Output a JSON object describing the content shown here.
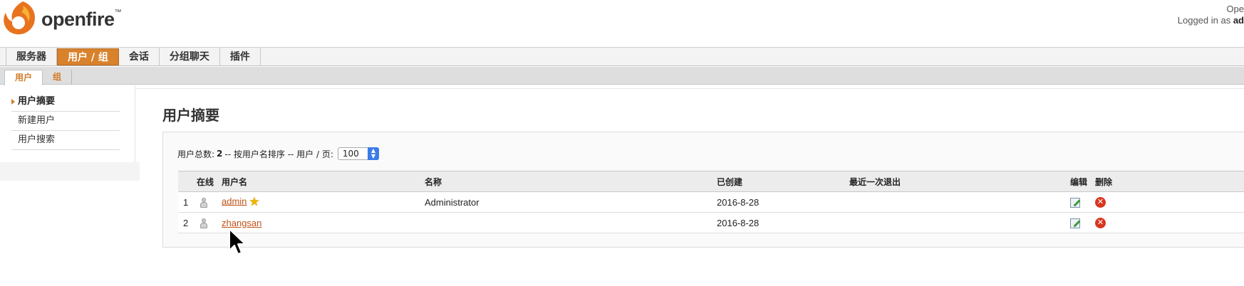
{
  "header": {
    "logo_text": "openfire",
    "logo_tm": "™",
    "info_line1": "Ope",
    "info_prefix": "Logged in as ",
    "info_user": "ad"
  },
  "main_nav": {
    "tabs": [
      {
        "label": "服务器",
        "active": false
      },
      {
        "label": "用户 / 组",
        "active": true
      },
      {
        "label": "会话",
        "active": false
      },
      {
        "label": "分组聊天",
        "active": false
      },
      {
        "label": "插件",
        "active": false
      }
    ]
  },
  "sub_nav": {
    "tabs": [
      {
        "label": "用户",
        "active": true
      },
      {
        "label": "组",
        "active": false
      }
    ]
  },
  "sidebar": {
    "items": [
      {
        "label": "用户摘要",
        "active": true
      },
      {
        "label": "新建用户",
        "active": false
      },
      {
        "label": "用户搜索",
        "active": false
      }
    ]
  },
  "content": {
    "title": "用户摘要",
    "summary_prefix": "用户总数:",
    "summary_total": "2",
    "summary_suffix": "-- 按用户名排序 -- 用户 / 页:",
    "per_page": "100"
  },
  "table": {
    "headers": {
      "online": "在线",
      "username": "用户名",
      "name": "名称",
      "created": "已创建",
      "last_logout": "最近一次退出",
      "edit": "编辑",
      "delete": "删除"
    },
    "rows": [
      {
        "index": "1",
        "username": "admin",
        "name": "Administrator",
        "created": "2016-8-28",
        "last_logout": "",
        "is_admin": true
      },
      {
        "index": "2",
        "username": "zhangsan",
        "name": "",
        "created": "2016-8-28",
        "last_logout": "",
        "is_admin": false
      }
    ]
  },
  "colors": {
    "accent": "#d8822c",
    "link": "#c0541a",
    "delete": "#d9361f"
  },
  "icons": {
    "online_status": "person-icon",
    "admin_badge": "star-icon",
    "edit": "edit-icon",
    "delete": "delete-icon"
  }
}
